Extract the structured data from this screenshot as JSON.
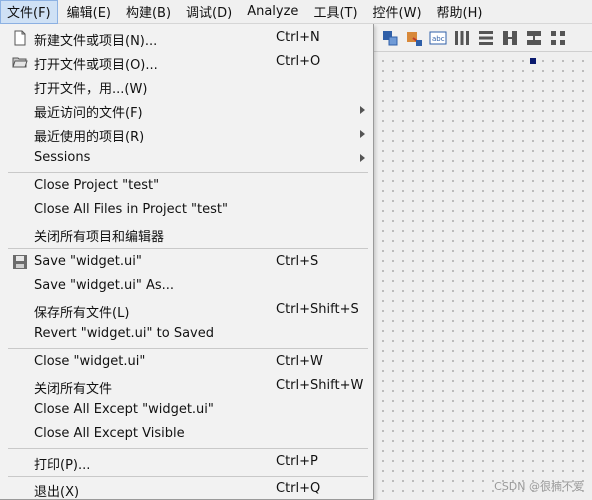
{
  "menubar": {
    "items": [
      "文件(F)",
      "编辑(E)",
      "构建(B)",
      "调试(D)",
      "Analyze",
      "工具(T)",
      "控件(W)",
      "帮助(H)"
    ]
  },
  "file_menu": {
    "new": {
      "label": "新建文件或项目(N)...",
      "shortcut": "Ctrl+N"
    },
    "open": {
      "label": "打开文件或项目(O)...",
      "shortcut": "Ctrl+O"
    },
    "open_with": {
      "label": "打开文件，用...(W)"
    },
    "recent_files": {
      "label": "最近访问的文件(F)"
    },
    "recent_projects": {
      "label": "最近使用的项目(R)"
    },
    "sessions": {
      "label": "Sessions"
    },
    "close_project": {
      "label": "Close Project \"test\""
    },
    "close_all_in_project": {
      "label": "Close All Files in Project \"test\""
    },
    "close_all_projects": {
      "label": "关闭所有项目和编辑器"
    },
    "save": {
      "label": "Save \"widget.ui\"",
      "shortcut": "Ctrl+S"
    },
    "save_as": {
      "label": "Save \"widget.ui\" As..."
    },
    "save_all": {
      "label": "保存所有文件(L)",
      "shortcut": "Ctrl+Shift+S"
    },
    "revert": {
      "label": "Revert \"widget.ui\" to Saved"
    },
    "close": {
      "label": "Close \"widget.ui\"",
      "shortcut": "Ctrl+W"
    },
    "close_all": {
      "label": "关闭所有文件",
      "shortcut": "Ctrl+Shift+W"
    },
    "close_all_except": {
      "label": "Close All Except \"widget.ui\""
    },
    "close_all_except_visible": {
      "label": "Close All Except Visible"
    },
    "print": {
      "label": "打印(P)...",
      "shortcut": "Ctrl+P"
    },
    "exit": {
      "label": "退出(X)",
      "shortcut": "Ctrl+Q"
    }
  },
  "watermark": "CSDN @很楠不爱"
}
